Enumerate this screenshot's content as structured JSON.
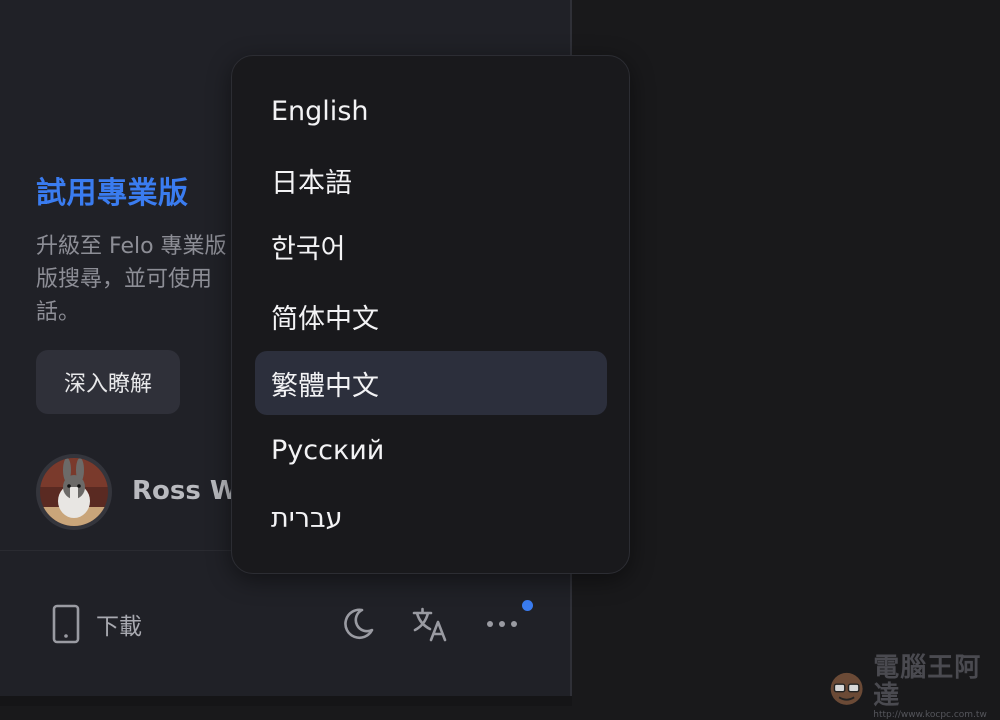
{
  "promo": {
    "title": "試用專業版",
    "desc_line1": "升級至 Felo 專業版",
    "desc_line2": "版搜尋，並可使用",
    "desc_line3": "話。",
    "learn_more": "深入瞭解"
  },
  "user": {
    "name": "Ross W"
  },
  "footer": {
    "download_label": "下載",
    "icons": [
      "phone-icon",
      "moon-icon",
      "translate-icon",
      "more-icon"
    ]
  },
  "language_menu": {
    "selected": "繁體中文",
    "items": [
      {
        "label": "English"
      },
      {
        "label": "日本語"
      },
      {
        "label": "한국어"
      },
      {
        "label": "简体中文"
      },
      {
        "label": "繁體中文"
      },
      {
        "label": "Русский"
      },
      {
        "label": "עברית"
      }
    ]
  },
  "watermark": {
    "title": "電腦王阿達",
    "url": "http://www.kocpc.com.tw"
  },
  "colors": {
    "accent": "#3a7cf0",
    "sidebar_bg": "#202127",
    "menu_bg": "#19191c",
    "selected_bg": "#2c2f3c"
  }
}
